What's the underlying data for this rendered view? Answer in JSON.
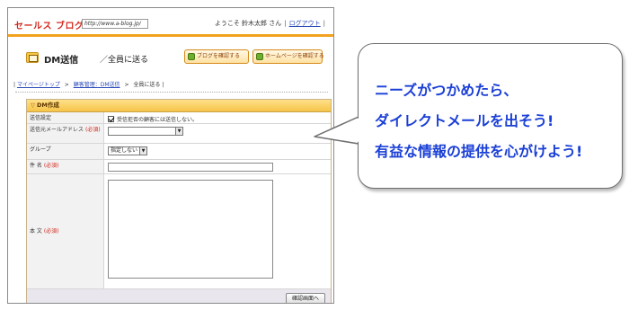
{
  "app": {
    "brand": "セールス ブログ",
    "url": "http://www.a-blog.jp/",
    "welcome": "ようこそ 鈴木太郎 さん",
    "logout": "ログアウト",
    "sep": "|"
  },
  "heading": {
    "title": "DM送信",
    "subtitle": "／全員に送る",
    "btn_blog": "ブログを確認する",
    "btn_home": "ホームページを確認する"
  },
  "breadcrumb": {
    "items": [
      "マイページトップ",
      "顧客管理：DM送信",
      "全員に送る"
    ],
    "sep": ">",
    "open": "|",
    "close": "|"
  },
  "form": {
    "section_title": "DM作成",
    "rows": [
      {
        "label": "送信設定",
        "required": ""
      },
      {
        "label": "送信元メールアドレス",
        "required": "(必須)"
      },
      {
        "label": "グループ",
        "required": ""
      },
      {
        "label": "件 名",
        "required": "(必須)"
      },
      {
        "label": "本 文",
        "required": "(必須)"
      }
    ],
    "checkbox_label": "受信拒否の顧客には送信しない。",
    "group_select": "指定しない",
    "submit": "確認画面へ"
  },
  "callout": {
    "line1": "ニーズがつかめたら、",
    "line2": "ダイレクトメールを出そう!",
    "line3": "有益な情報の提供を心がけよう!"
  },
  "colors": {
    "accent_orange": "#f2a21e",
    "brand_red": "#d4281c",
    "link_blue": "#2a4bb8",
    "callout_blue": "#1a3fd6"
  }
}
